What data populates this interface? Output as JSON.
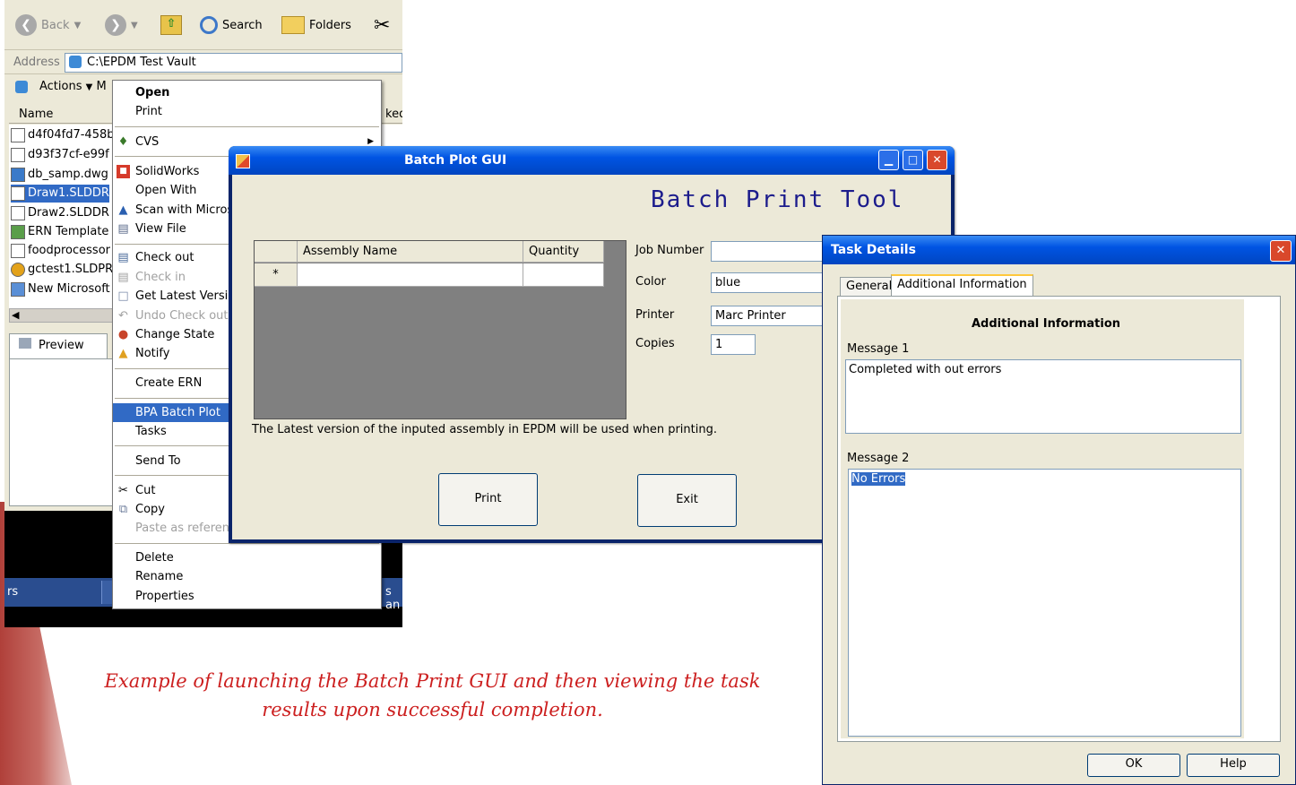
{
  "explorer": {
    "toolbar": {
      "back": "Back",
      "search": "Search",
      "folders": "Folders"
    },
    "address": {
      "label": "Address",
      "value": "C:\\EPDM Test Vault"
    },
    "actions_label": "Actions",
    "actions_extra": "M",
    "columns": {
      "name": "Name",
      "checked": "ked"
    },
    "files": [
      "d4f04fd7-458b",
      "d93f37cf-e99f",
      "db_samp.dwg",
      "Draw1.SLDDR",
      "Draw2.SLDDR",
      "ERN Template",
      "foodprocessor",
      "gctest1.SLDPR",
      "New Microsoft"
    ],
    "preview_tab": "Preview",
    "taskbar_left": "rs",
    "taskbar_right": "s an"
  },
  "context_menu": {
    "items": [
      "Open",
      "Print",
      "CVS",
      "SolidWorks",
      "Open With",
      "Scan with Microso",
      "View File",
      "Check out",
      "Check in",
      "Get Latest Versio",
      "Undo Check out",
      "Change State",
      "Notify",
      "Create ERN",
      "BPA Batch Plot",
      "Tasks",
      "Send To",
      "Cut",
      "Copy",
      "Paste as referen",
      "Delete",
      "Rename",
      "Properties"
    ]
  },
  "batch_window": {
    "title": "Batch Plot GUI",
    "tool_title": "Batch Print Tool",
    "grid": {
      "col_assembly": "Assembly Name",
      "col_quantity": "Quantity",
      "new_row_marker": "*"
    },
    "fields": {
      "job_label": "Job Number",
      "job_value": "",
      "color_label": "Color",
      "color_value": "blue",
      "printer_label": "Printer",
      "printer_value": "Marc Printer",
      "copies_label": "Copies",
      "copies_value": "1"
    },
    "note": "The Latest version of the inputed assembly in EPDM will be used when printing.",
    "print_button": "Print",
    "exit_button": "Exit"
  },
  "task_details": {
    "title": "Task Details",
    "tabs": [
      "General",
      "Additional Information"
    ],
    "heading": "Additional Information",
    "message1_label": "Message 1",
    "message1_value": "Completed with out errors",
    "message2_label": "Message 2",
    "message2_value": "No Errors",
    "ok_button": "OK",
    "help_button": "Help"
  },
  "caption": {
    "line1": "Example of launching the Batch Print GUI and then viewing the task",
    "line2": "results upon successful completion."
  },
  "colors": {
    "xp_blue": "#0054e3",
    "selection": "#316ac5",
    "caption_red": "#cc1f1f",
    "tool_title": "#1c1c8c"
  }
}
